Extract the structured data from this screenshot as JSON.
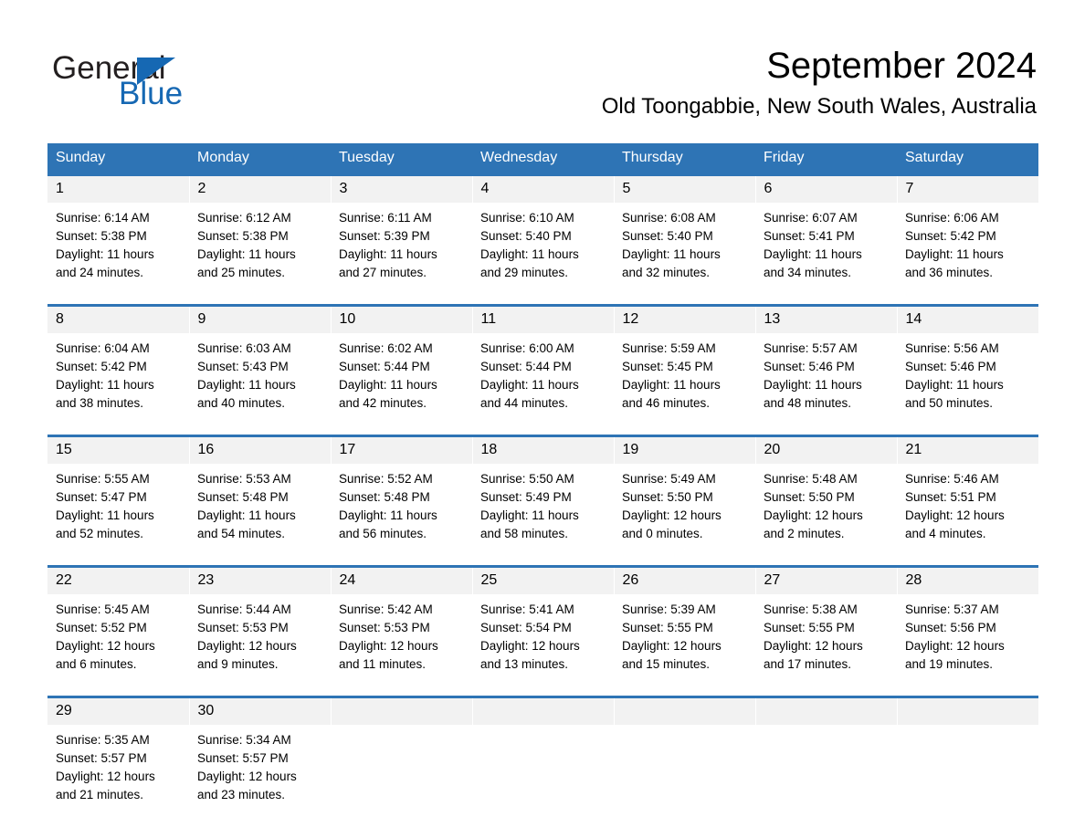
{
  "brand": {
    "name_part1": "General",
    "name_part2": "Blue",
    "triangle_icon": "triangle-icon",
    "colors": {
      "black": "#231f20",
      "blue": "#1668b3"
    }
  },
  "header": {
    "month_title": "September 2024",
    "location": "Old Toongabbie, New South Wales, Australia"
  },
  "theme": {
    "header_blue": "#2e74b5",
    "daynum_band": "#f2f2f2",
    "page_background": "#ffffff",
    "text": "#000000"
  },
  "calendar": {
    "weekday_headers": [
      "Sunday",
      "Monday",
      "Tuesday",
      "Wednesday",
      "Thursday",
      "Friday",
      "Saturday"
    ],
    "weeks": [
      [
        {
          "day": "1",
          "sunrise": "Sunrise: 6:14 AM",
          "sunset": "Sunset: 5:38 PM",
          "daylight_line1": "Daylight: 11 hours",
          "daylight_line2": "and 24 minutes."
        },
        {
          "day": "2",
          "sunrise": "Sunrise: 6:12 AM",
          "sunset": "Sunset: 5:38 PM",
          "daylight_line1": "Daylight: 11 hours",
          "daylight_line2": "and 25 minutes."
        },
        {
          "day": "3",
          "sunrise": "Sunrise: 6:11 AM",
          "sunset": "Sunset: 5:39 PM",
          "daylight_line1": "Daylight: 11 hours",
          "daylight_line2": "and 27 minutes."
        },
        {
          "day": "4",
          "sunrise": "Sunrise: 6:10 AM",
          "sunset": "Sunset: 5:40 PM",
          "daylight_line1": "Daylight: 11 hours",
          "daylight_line2": "and 29 minutes."
        },
        {
          "day": "5",
          "sunrise": "Sunrise: 6:08 AM",
          "sunset": "Sunset: 5:40 PM",
          "daylight_line1": "Daylight: 11 hours",
          "daylight_line2": "and 32 minutes."
        },
        {
          "day": "6",
          "sunrise": "Sunrise: 6:07 AM",
          "sunset": "Sunset: 5:41 PM",
          "daylight_line1": "Daylight: 11 hours",
          "daylight_line2": "and 34 minutes."
        },
        {
          "day": "7",
          "sunrise": "Sunrise: 6:06 AM",
          "sunset": "Sunset: 5:42 PM",
          "daylight_line1": "Daylight: 11 hours",
          "daylight_line2": "and 36 minutes."
        }
      ],
      [
        {
          "day": "8",
          "sunrise": "Sunrise: 6:04 AM",
          "sunset": "Sunset: 5:42 PM",
          "daylight_line1": "Daylight: 11 hours",
          "daylight_line2": "and 38 minutes."
        },
        {
          "day": "9",
          "sunrise": "Sunrise: 6:03 AM",
          "sunset": "Sunset: 5:43 PM",
          "daylight_line1": "Daylight: 11 hours",
          "daylight_line2": "and 40 minutes."
        },
        {
          "day": "10",
          "sunrise": "Sunrise: 6:02 AM",
          "sunset": "Sunset: 5:44 PM",
          "daylight_line1": "Daylight: 11 hours",
          "daylight_line2": "and 42 minutes."
        },
        {
          "day": "11",
          "sunrise": "Sunrise: 6:00 AM",
          "sunset": "Sunset: 5:44 PM",
          "daylight_line1": "Daylight: 11 hours",
          "daylight_line2": "and 44 minutes."
        },
        {
          "day": "12",
          "sunrise": "Sunrise: 5:59 AM",
          "sunset": "Sunset: 5:45 PM",
          "daylight_line1": "Daylight: 11 hours",
          "daylight_line2": "and 46 minutes."
        },
        {
          "day": "13",
          "sunrise": "Sunrise: 5:57 AM",
          "sunset": "Sunset: 5:46 PM",
          "daylight_line1": "Daylight: 11 hours",
          "daylight_line2": "and 48 minutes."
        },
        {
          "day": "14",
          "sunrise": "Sunrise: 5:56 AM",
          "sunset": "Sunset: 5:46 PM",
          "daylight_line1": "Daylight: 11 hours",
          "daylight_line2": "and 50 minutes."
        }
      ],
      [
        {
          "day": "15",
          "sunrise": "Sunrise: 5:55 AM",
          "sunset": "Sunset: 5:47 PM",
          "daylight_line1": "Daylight: 11 hours",
          "daylight_line2": "and 52 minutes."
        },
        {
          "day": "16",
          "sunrise": "Sunrise: 5:53 AM",
          "sunset": "Sunset: 5:48 PM",
          "daylight_line1": "Daylight: 11 hours",
          "daylight_line2": "and 54 minutes."
        },
        {
          "day": "17",
          "sunrise": "Sunrise: 5:52 AM",
          "sunset": "Sunset: 5:48 PM",
          "daylight_line1": "Daylight: 11 hours",
          "daylight_line2": "and 56 minutes."
        },
        {
          "day": "18",
          "sunrise": "Sunrise: 5:50 AM",
          "sunset": "Sunset: 5:49 PM",
          "daylight_line1": "Daylight: 11 hours",
          "daylight_line2": "and 58 minutes."
        },
        {
          "day": "19",
          "sunrise": "Sunrise: 5:49 AM",
          "sunset": "Sunset: 5:50 PM",
          "daylight_line1": "Daylight: 12 hours",
          "daylight_line2": "and 0 minutes."
        },
        {
          "day": "20",
          "sunrise": "Sunrise: 5:48 AM",
          "sunset": "Sunset: 5:50 PM",
          "daylight_line1": "Daylight: 12 hours",
          "daylight_line2": "and 2 minutes."
        },
        {
          "day": "21",
          "sunrise": "Sunrise: 5:46 AM",
          "sunset": "Sunset: 5:51 PM",
          "daylight_line1": "Daylight: 12 hours",
          "daylight_line2": "and 4 minutes."
        }
      ],
      [
        {
          "day": "22",
          "sunrise": "Sunrise: 5:45 AM",
          "sunset": "Sunset: 5:52 PM",
          "daylight_line1": "Daylight: 12 hours",
          "daylight_line2": "and 6 minutes."
        },
        {
          "day": "23",
          "sunrise": "Sunrise: 5:44 AM",
          "sunset": "Sunset: 5:53 PM",
          "daylight_line1": "Daylight: 12 hours",
          "daylight_line2": "and 9 minutes."
        },
        {
          "day": "24",
          "sunrise": "Sunrise: 5:42 AM",
          "sunset": "Sunset: 5:53 PM",
          "daylight_line1": "Daylight: 12 hours",
          "daylight_line2": "and 11 minutes."
        },
        {
          "day": "25",
          "sunrise": "Sunrise: 5:41 AM",
          "sunset": "Sunset: 5:54 PM",
          "daylight_line1": "Daylight: 12 hours",
          "daylight_line2": "and 13 minutes."
        },
        {
          "day": "26",
          "sunrise": "Sunrise: 5:39 AM",
          "sunset": "Sunset: 5:55 PM",
          "daylight_line1": "Daylight: 12 hours",
          "daylight_line2": "and 15 minutes."
        },
        {
          "day": "27",
          "sunrise": "Sunrise: 5:38 AM",
          "sunset": "Sunset: 5:55 PM",
          "daylight_line1": "Daylight: 12 hours",
          "daylight_line2": "and 17 minutes."
        },
        {
          "day": "28",
          "sunrise": "Sunrise: 5:37 AM",
          "sunset": "Sunset: 5:56 PM",
          "daylight_line1": "Daylight: 12 hours",
          "daylight_line2": "and 19 minutes."
        }
      ],
      [
        {
          "day": "29",
          "sunrise": "Sunrise: 5:35 AM",
          "sunset": "Sunset: 5:57 PM",
          "daylight_line1": "Daylight: 12 hours",
          "daylight_line2": "and 21 minutes."
        },
        {
          "day": "30",
          "sunrise": "Sunrise: 5:34 AM",
          "sunset": "Sunset: 5:57 PM",
          "daylight_line1": "Daylight: 12 hours",
          "daylight_line2": "and 23 minutes."
        },
        {
          "day": "",
          "sunrise": "",
          "sunset": "",
          "daylight_line1": "",
          "daylight_line2": ""
        },
        {
          "day": "",
          "sunrise": "",
          "sunset": "",
          "daylight_line1": "",
          "daylight_line2": ""
        },
        {
          "day": "",
          "sunrise": "",
          "sunset": "",
          "daylight_line1": "",
          "daylight_line2": ""
        },
        {
          "day": "",
          "sunrise": "",
          "sunset": "",
          "daylight_line1": "",
          "daylight_line2": ""
        },
        {
          "day": "",
          "sunrise": "",
          "sunset": "",
          "daylight_line1": "",
          "daylight_line2": ""
        }
      ]
    ]
  }
}
